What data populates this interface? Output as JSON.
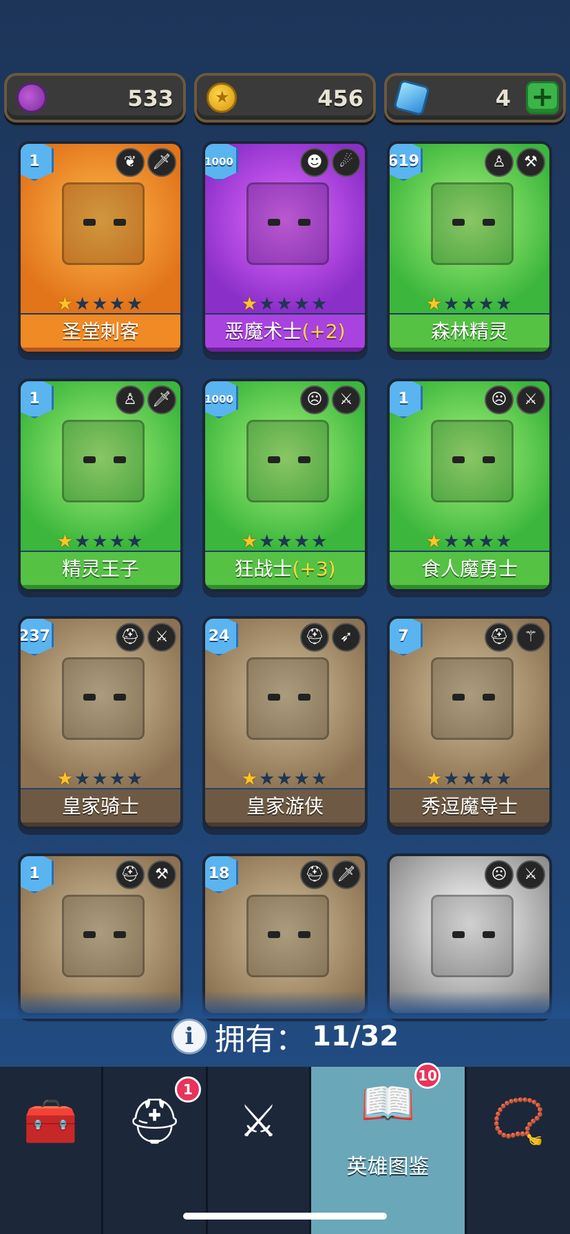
{
  "currencies": [
    {
      "icon": "ticket-icon",
      "value": "533"
    },
    {
      "icon": "coin-icon",
      "value": "456"
    },
    {
      "icon": "gem-icon",
      "value": "4",
      "add": "+"
    }
  ],
  "heroes": [
    {
      "name": "圣堂刺客",
      "bonus": "",
      "level": "1",
      "theme": "orange",
      "stars": 1,
      "badges": [
        "wings-icon",
        "dagger-icon"
      ]
    },
    {
      "name": "恶魔术士",
      "bonus": "(+2)",
      "level": "1000",
      "theme": "purple",
      "stars": 1,
      "badges": [
        "demon-icon",
        "flame-icon"
      ]
    },
    {
      "name": "森林精灵",
      "bonus": "",
      "level": "619",
      "theme": "green",
      "stars": 1,
      "badges": [
        "elf-icon",
        "hammer-icon"
      ]
    },
    {
      "name": "精灵王子",
      "bonus": "",
      "level": "1",
      "theme": "green",
      "stars": 1,
      "badges": [
        "elf-icon",
        "dagger-icon"
      ]
    },
    {
      "name": "狂战士",
      "bonus": "(+3)",
      "level": "1000",
      "theme": "green",
      "stars": 1,
      "badges": [
        "orc-icon",
        "sword-icon"
      ]
    },
    {
      "name": "食人魔勇士",
      "bonus": "",
      "level": "1",
      "theme": "green",
      "stars": 1,
      "badges": [
        "orc-icon",
        "sword-icon"
      ]
    },
    {
      "name": "皇家骑士",
      "bonus": "",
      "level": "237",
      "theme": "brown",
      "stars": 1,
      "badges": [
        "helmet-icon",
        "sword-icon"
      ]
    },
    {
      "name": "皇家游侠",
      "bonus": "",
      "level": "24",
      "theme": "brown",
      "stars": 1,
      "badges": [
        "helmet-icon",
        "bow-icon"
      ]
    },
    {
      "name": "秀逗魔导士",
      "bonus": "",
      "level": "7",
      "theme": "brown",
      "stars": 1,
      "badges": [
        "helmet-icon",
        "staff-icon"
      ]
    },
    {
      "name": "",
      "bonus": "",
      "level": "1",
      "theme": "brown",
      "stars": 0,
      "badges": [
        "helmet-icon",
        "hammer-icon"
      ]
    },
    {
      "name": "",
      "bonus": "",
      "level": "18",
      "theme": "brown",
      "stars": 0,
      "badges": [
        "helmet-icon",
        "dagger-icon"
      ]
    },
    {
      "name": "",
      "bonus": "",
      "level": "",
      "theme": "gray",
      "stars": 0,
      "badges": [
        "orc-icon",
        "sword-icon"
      ]
    }
  ],
  "owned": {
    "label": "拥有：",
    "count": "11/32"
  },
  "nav": {
    "items": [
      {
        "icon": "chest-icon",
        "label": ""
      },
      {
        "icon": "viking-helmet-icon",
        "label": "",
        "badge": "1"
      },
      {
        "icon": "crossed-swords-icon",
        "label": ""
      },
      {
        "icon": "hero-book-icon",
        "label": "英雄图鉴",
        "badge": "10"
      },
      {
        "icon": "amulet-icon",
        "label": ""
      }
    ]
  }
}
